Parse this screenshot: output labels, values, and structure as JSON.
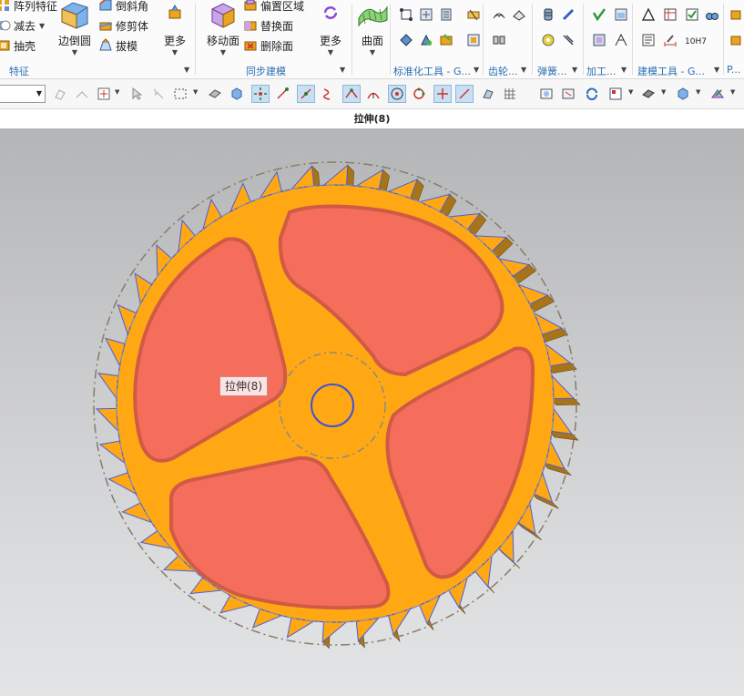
{
  "ribbon": {
    "feature_group": {
      "items": [
        "阵列特征",
        "减去",
        "抽壳"
      ],
      "edge_blend": "边倒圆",
      "right_items": [
        "倒斜角",
        "修剪体",
        "拔模"
      ],
      "more": "更多",
      "label": "特征"
    },
    "sync_group": {
      "move_face": "移动面",
      "items": [
        "偏置区域",
        "替换面",
        "删除面"
      ],
      "more": "更多",
      "label": "同步建模"
    },
    "surface": {
      "label": "曲面"
    },
    "labels": {
      "standard_tools": "标准化工具 - G...",
      "gear": "齿轮...",
      "spring": "弹簧...",
      "machining": "加工...",
      "modeling_tools": "建模工具 - G...",
      "overflow": "P..."
    },
    "tolerance_icon_text": "10H7"
  },
  "toolbar2": {
    "selection_filter_value": ""
  },
  "window": {
    "title": "拉伸(8)"
  },
  "viewport": {
    "tooltip": "拉伸(8)",
    "colors": {
      "body": "#ffa814",
      "face_highlight": "#f56e5c",
      "edge": "#4b5ed8",
      "preselect": "#d05a44"
    }
  }
}
